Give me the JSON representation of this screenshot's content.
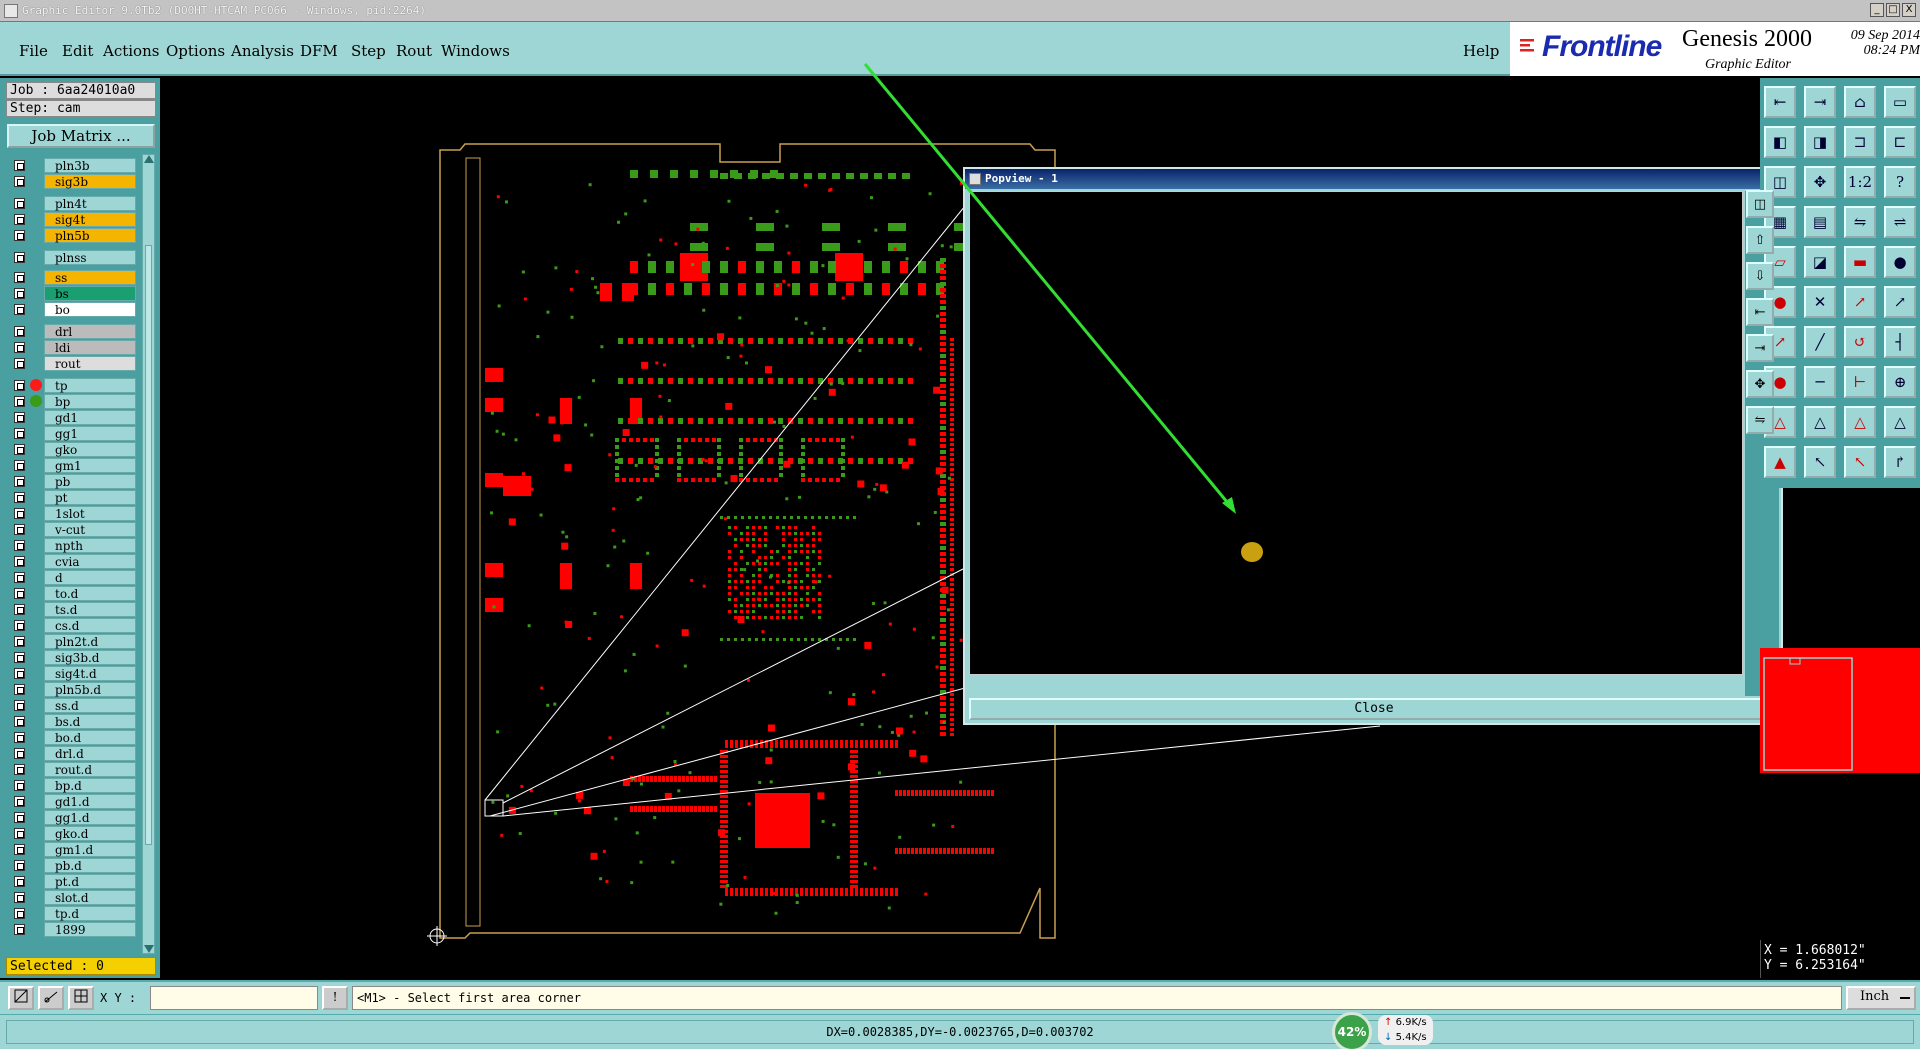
{
  "window": {
    "title": "Graphic Editor 9.0Tb2 (DO0HT-HTCAM-PC066 - Windows, pid:2264)",
    "controls": [
      "_",
      "□",
      "X"
    ]
  },
  "menu": {
    "items": [
      "File",
      "Edit",
      "Actions",
      "Options",
      "Analysis",
      "DFM",
      "Step",
      "Rout",
      "Windows"
    ],
    "help": "Help"
  },
  "brand": {
    "logo": "Frontline",
    "product": "Genesis 2000",
    "subtitle": "Graphic Editor",
    "date": "09 Sep 2014",
    "time": "08:24 PM"
  },
  "job": {
    "job_label": "Job : 6aa24010a0",
    "step_label": "Step: cam",
    "matrix_button": "Job Matrix ..."
  },
  "layers": [
    {
      "name": "pln3b",
      "color": "#9ed6d6",
      "mark": ""
    },
    {
      "name": "sig3b",
      "color": "#f4b400",
      "mark": "✎"
    },
    {
      "name": "pln4t",
      "color": "#9ed6d6",
      "mark": ""
    },
    {
      "name": "sig4t",
      "color": "#f4b400",
      "mark": "✎"
    },
    {
      "name": "pln5b",
      "color": "#f4b400",
      "mark": "✎"
    },
    {
      "name": "plnss",
      "color": "#9ed6d6",
      "mark": ""
    },
    {
      "name": "ss",
      "color": "#f4b400",
      "mark": "✎"
    },
    {
      "name": "bs",
      "color": "#1aa070",
      "mark": ""
    },
    {
      "name": "bo",
      "color": "#ffffff",
      "mark": "✎"
    },
    {
      "name": "drl",
      "color": "#bbbbbb",
      "mark": ""
    },
    {
      "name": "ldi",
      "color": "#bbbbbb",
      "mark": ""
    },
    {
      "name": "rout",
      "color": "#dddddd",
      "mark": ""
    },
    {
      "name": "tp",
      "color": "#9ed6d6",
      "mark": "▪"
    },
    {
      "name": "bp",
      "color": "#9ed6d6",
      "mark": ""
    },
    {
      "name": "gd1",
      "color": "#9ed6d6",
      "mark": "✎"
    },
    {
      "name": "gg1",
      "color": "#9ed6d6",
      "mark": ""
    },
    {
      "name": "gko",
      "color": "#9ed6d6",
      "mark": ""
    },
    {
      "name": "gm1",
      "color": "#9ed6d6",
      "mark": ""
    },
    {
      "name": "pb",
      "color": "#9ed6d6",
      "mark": ""
    },
    {
      "name": "pt",
      "color": "#9ed6d6",
      "mark": ""
    },
    {
      "name": "1slot",
      "color": "#9ed6d6",
      "mark": ""
    },
    {
      "name": "v-cut",
      "color": "#9ed6d6",
      "mark": ""
    },
    {
      "name": "npth",
      "color": "#9ed6d6",
      "mark": ""
    },
    {
      "name": "cvia",
      "color": "#9ed6d6",
      "mark": ""
    },
    {
      "name": "d",
      "color": "#9ed6d6",
      "mark": ""
    },
    {
      "name": "to.d",
      "color": "#9ed6d6",
      "mark": "✎"
    },
    {
      "name": "ts.d",
      "color": "#9ed6d6",
      "mark": ""
    },
    {
      "name": "cs.d",
      "color": "#9ed6d6",
      "mark": "✎"
    },
    {
      "name": "pln2t.d",
      "color": "#9ed6d6",
      "mark": "✎"
    },
    {
      "name": "sig3b.d",
      "color": "#9ed6d6",
      "mark": "✎"
    },
    {
      "name": "sig4t.d",
      "color": "#9ed6d6",
      "mark": "✎"
    },
    {
      "name": "pln5b.d",
      "color": "#9ed6d6",
      "mark": "✎"
    },
    {
      "name": "ss.d",
      "color": "#9ed6d6",
      "mark": "✎"
    },
    {
      "name": "bs.d",
      "color": "#9ed6d6",
      "mark": ""
    },
    {
      "name": "bo.d",
      "color": "#9ed6d6",
      "mark": "✎"
    },
    {
      "name": "drl.d",
      "color": "#9ed6d6",
      "mark": ""
    },
    {
      "name": "rout.d",
      "color": "#9ed6d6",
      "mark": ""
    },
    {
      "name": "bp.d",
      "color": "#9ed6d6",
      "mark": ""
    },
    {
      "name": "gd1.d",
      "color": "#9ed6d6",
      "mark": "✎"
    },
    {
      "name": "gg1.d",
      "color": "#9ed6d6",
      "mark": ""
    },
    {
      "name": "gko.d",
      "color": "#9ed6d6",
      "mark": ""
    },
    {
      "name": "gm1.d",
      "color": "#9ed6d6",
      "mark": ""
    },
    {
      "name": "pb.d",
      "color": "#9ed6d6",
      "mark": ""
    },
    {
      "name": "pt.d",
      "color": "#9ed6d6",
      "mark": ""
    },
    {
      "name": "slot.d",
      "color": "#9ed6d6",
      "mark": ""
    },
    {
      "name": "tp.d",
      "color": "#9ed6d6",
      "mark": ""
    },
    {
      "name": "1899",
      "color": "#9ed6d6",
      "mark": ""
    }
  ],
  "selected": "Selected : 0",
  "popview": {
    "title": "Popview - 1",
    "close": "Close",
    "close_x": "X"
  },
  "coords": {
    "x": "X = 1.668012\"",
    "y": "Y = 6.253164\""
  },
  "cmd": {
    "xy_label": "X Y :",
    "xy_value": "",
    "excl": "!",
    "prompt": "<M1> - Select first area corner",
    "units": "Inch"
  },
  "status": {
    "measure": "DX=0.0028385,DY=-0.0023765,D=0.003702"
  },
  "network": {
    "percent": "42%",
    "up": "6.9K/s",
    "down": "5.4K/s"
  },
  "colors": {
    "panel": "#9ed6d6",
    "accent_blue": "#1a2bb0",
    "pad_red": "#ff0000",
    "pad_green": "#3a9a1a",
    "outline": "#c8a050",
    "arrow": "#33dd33"
  }
}
